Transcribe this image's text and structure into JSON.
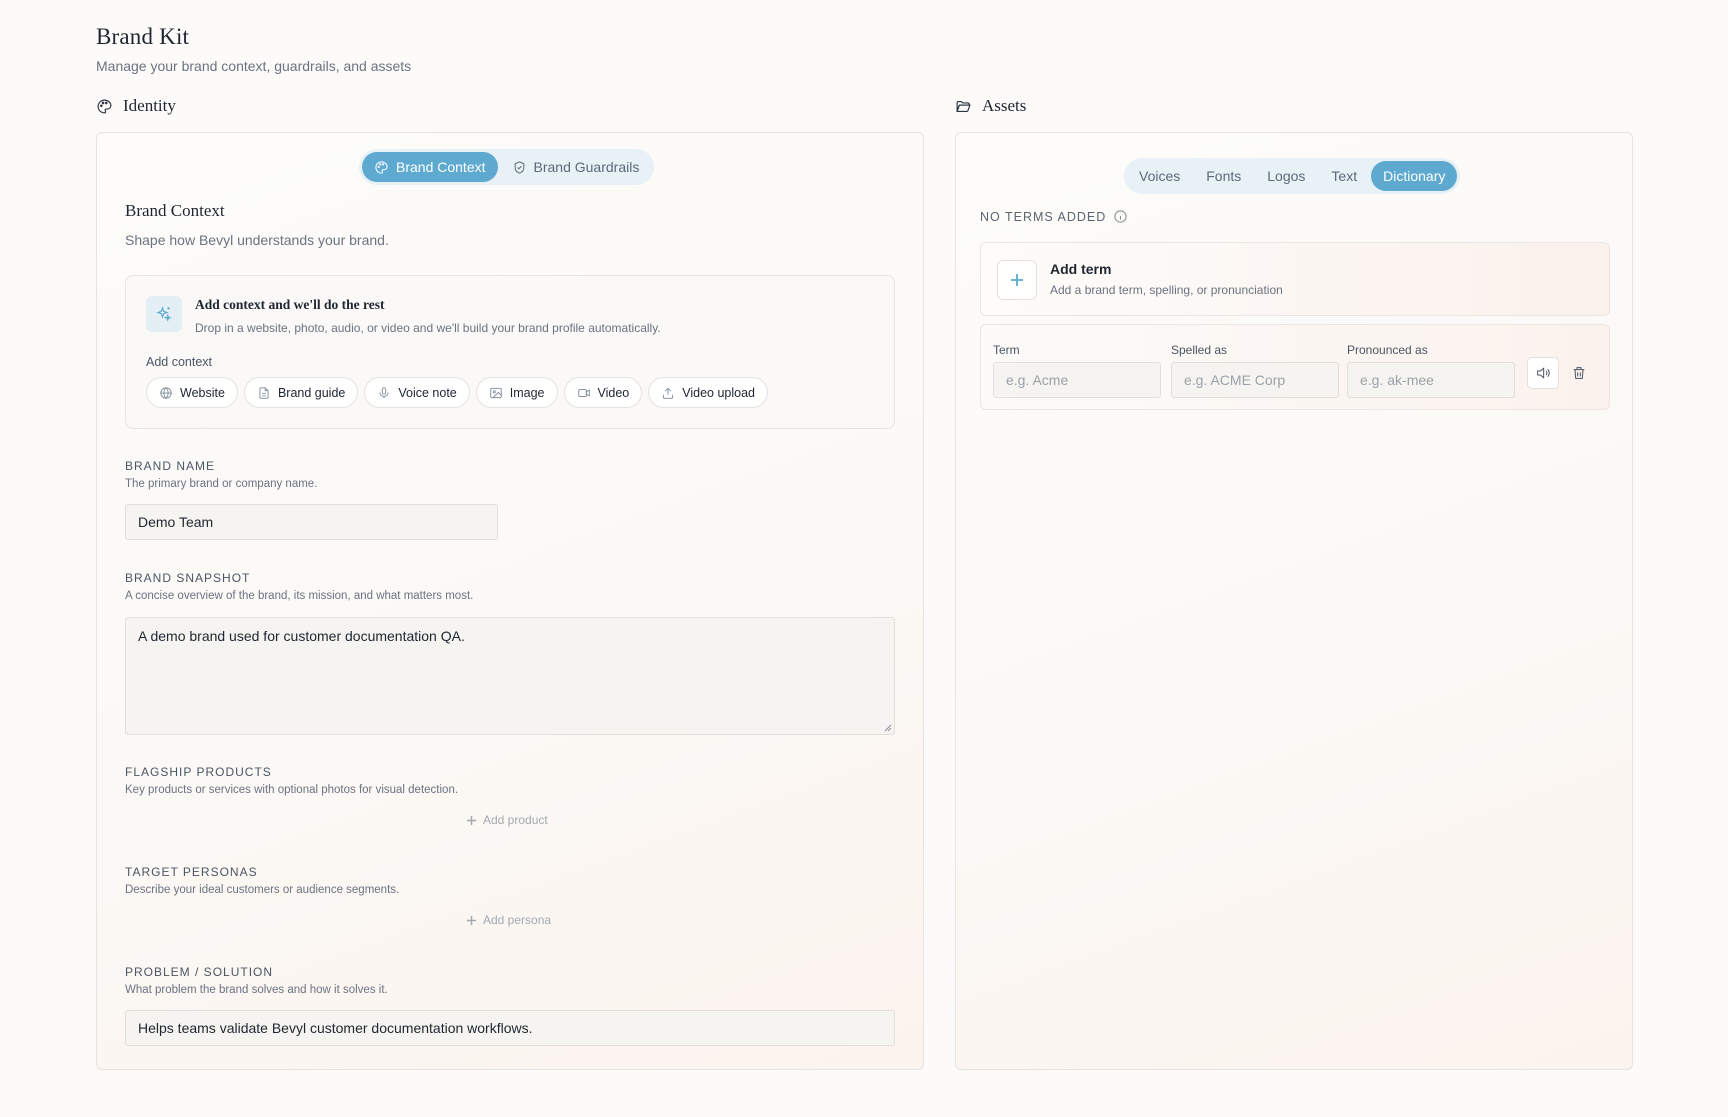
{
  "page": {
    "title": "Brand Kit",
    "subtitle": "Manage your brand context, guardrails, and assets"
  },
  "identity": {
    "section_label": "Identity",
    "tabs": [
      {
        "label": "Brand Context",
        "icon": "palette-icon",
        "active": true
      },
      {
        "label": "Brand Guardrails",
        "icon": "shield-icon",
        "active": false
      }
    ],
    "heading": "Brand Context",
    "description": "Shape how Bevyl understands your brand.",
    "context_card": {
      "title": "Add context and we'll do the rest",
      "description": "Drop in a website, photo, audio, or video and we'll build your brand profile automatically.",
      "add_label": "Add context",
      "chips": [
        {
          "label": "Website",
          "icon": "globe-icon"
        },
        {
          "label": "Brand guide",
          "icon": "document-icon"
        },
        {
          "label": "Voice note",
          "icon": "microphone-icon"
        },
        {
          "label": "Image",
          "icon": "image-icon"
        },
        {
          "label": "Video",
          "icon": "video-camera-icon"
        },
        {
          "label": "Video upload",
          "icon": "upload-icon"
        }
      ]
    },
    "fields": {
      "brand_name": {
        "label": "BRAND NAME",
        "help": "The primary brand or company name.",
        "value": "Demo Team"
      },
      "brand_snapshot": {
        "label": "BRAND SNAPSHOT",
        "help": "A concise overview of the brand, its mission, and what matters most.",
        "value": "A demo brand used for customer documentation QA."
      },
      "flagship_products": {
        "label": "FLAGSHIP PRODUCTS",
        "help": "Key products or services with optional photos for visual detection.",
        "add_label": "Add product"
      },
      "target_personas": {
        "label": "TARGET PERSONAS",
        "help": "Describe your ideal customers or audience segments.",
        "add_label": "Add persona"
      },
      "problem_solution": {
        "label": "PROBLEM / SOLUTION",
        "help": "What problem the brand solves and how it solves it.",
        "value": "Helps teams validate Bevyl customer documentation workflows."
      }
    }
  },
  "assets": {
    "section_label": "Assets",
    "tabs": [
      {
        "label": "Voices",
        "active": false
      },
      {
        "label": "Fonts",
        "active": false
      },
      {
        "label": "Logos",
        "active": false
      },
      {
        "label": "Text",
        "active": false
      },
      {
        "label": "Dictionary",
        "active": true
      }
    ],
    "status": "NO TERMS ADDED",
    "add_term": {
      "title": "Add term",
      "description": "Add a brand term, spelling, or pronunciation"
    },
    "term_row": {
      "term_label": "Term",
      "term_placeholder": "e.g. Acme",
      "spelled_label": "Spelled as",
      "spelled_placeholder": "e.g. ACME Corp",
      "pronounced_label": "Pronounced as",
      "pronounced_placeholder": "e.g. ak-mee"
    }
  },
  "colors": {
    "accent": "#5ea9cf",
    "accent_soft": "#e8f1f6",
    "background": "#fcfbf9"
  }
}
